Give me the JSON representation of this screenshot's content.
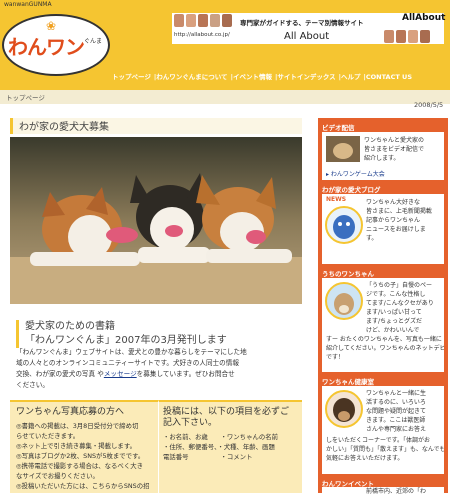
{
  "header": {
    "logo_top": "wanwanGUNMA",
    "logo_main": "わんワン",
    "logo_sub": "ぐんま",
    "allabout_tagline": "専門家がガイドする、テーマ別情報サイト",
    "allabout_brand": "AllAbout",
    "allabout_url": "http://allabout.co.jp/",
    "allabout_name": "All About"
  },
  "nav": {
    "items": [
      "トップページ",
      "わんワンぐんまについて",
      "イベント情報",
      "サイトインデックス",
      "ヘルプ",
      "CONTACT US"
    ]
  },
  "breadcrumb": "トップページ",
  "date": "2008/5/5",
  "main": {
    "title": "わが家の愛犬大募集",
    "book_title_line1": "愛犬家のための書籍",
    "book_title_line2": "「わんワンぐんま」2007年の3月発刊します",
    "body_1": "「わんワンぐんま」ウェブサイトは、愛犬との豊かな暮らしをテーマにした地",
    "body_2": "域の人々とのオンラインコミュニティーサイトです。犬好きの人同士の情報",
    "body_3": "交換、わが家の愛犬の写真 や",
    "body_link": "メッセージ",
    "body_4": "を募集しています。ぜひお問合せ",
    "body_5": "ください。"
  },
  "box_left": {
    "title": "ワンちゃん写真応募の方へ",
    "items": [
      "◎書籍への掲載は、3月8日受付分で締め切",
      "らせていただきます。",
      "◎ネット上で引き続き募集・掲載します。",
      "◎写真はブログか2枚、SNSが5枚までです。",
      "◎携帯電話で撮影する場合は、なるべく大き",
      "なサイズでお撮りください。",
      "◎投稿いただいた方には、こちらからSNSの招"
    ]
  },
  "box_right": {
    "title_1": "投稿には、以下の項目を必ずご",
    "title_2": "記入下さい。",
    "items": [
      "・お名前、お歳　　・ワンちゃんの名前",
      "・住所、郵便番号、・犬種、年齢、画題",
      "電話番号　　　　　・コメント"
    ]
  },
  "sidebar": {
    "video_header": "ビデオ配信",
    "video_text": [
      "ワンちゃんと愛犬家の",
      "皆さまをビデオ配信で",
      "紹介します。"
    ],
    "video_link": "わんワンゲーム大会",
    "blog_header": "わが家の愛犬ブログ",
    "news_label": "NEWS",
    "news_text": [
      "ワンちゃん大好きな",
      "皆さまに、上毛新聞掲載",
      "記事からワンちゃん",
      "ニュースをお届けしま",
      "す。"
    ],
    "uchi_header": "うちのワンちゃん",
    "uchi_text": [
      "「うちの子」自慢のペー",
      "ジです。こんな性格し",
      "てます/こんなクセがあり",
      "ます/いっぱい甘って",
      "ます/ちょっとグズだ",
      "けど、かわいいんで",
      "すー おたくのワンちゃんを、写真も一緒に",
      "紹介してください。ワンちゃんのネットデビュー",
      "です！"
    ],
    "clinic_header": "ワンちゃん健康室",
    "clinic_text": [
      "ワンちゃんと一緒に生",
      "活するのに、いろいろ",
      "な問題や疑問が起きて",
      "きます。ここは獣医師",
      "さんや専門家にお答え",
      "しをいただくコーナーです。「体調がお",
      "かしい」「質問も」「散えます」も、なんでも",
      "気軽にお答えいただけます。"
    ],
    "event_header": "わんワンイベント",
    "event_text": "前橋市内、近郊の「わ"
  },
  "colors": {
    "accent_yellow": "#f5c531",
    "sidebar_orange": "#e5612c",
    "logo_red": "#e04d1c"
  }
}
